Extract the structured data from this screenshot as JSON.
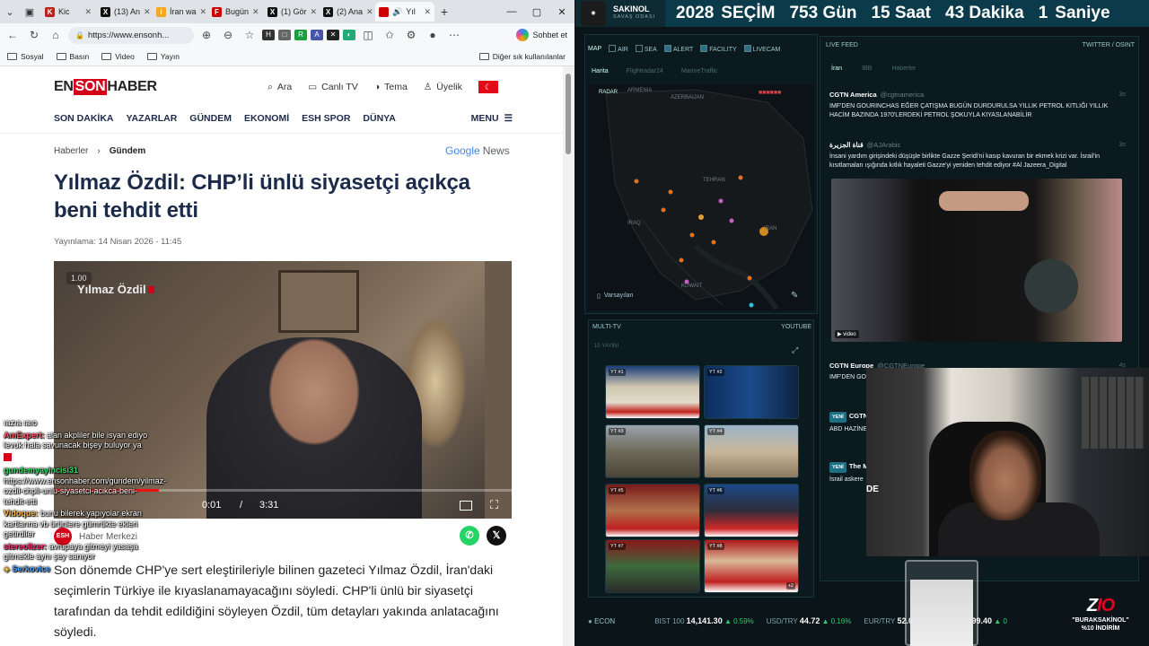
{
  "browser": {
    "tabs": [
      {
        "title": "Kic",
        "favicon": "K",
        "color": "#b22"
      },
      {
        "title": "(13) An",
        "favicon": "X",
        "color": "#111"
      },
      {
        "title": "İran wa",
        "favicon": "i",
        "color": "#f5a623"
      },
      {
        "title": "Bugün",
        "favicon": "F",
        "color": "#c00"
      },
      {
        "title": "(1) Gör",
        "favicon": "X",
        "color": "#111"
      },
      {
        "title": "(2) Ana",
        "favicon": "X",
        "color": "#111"
      },
      {
        "title": "Yıl",
        "favicon": "",
        "color": "#c00",
        "active": true
      }
    ],
    "url": "https://www.ensonh...",
    "copilot_label": "Sohbet et",
    "bookmarks": [
      "Sosyal",
      "Basın",
      "Video",
      "Yayın"
    ],
    "bookmarks_right": "Diğer sık kullanılanlar"
  },
  "site": {
    "logo": {
      "en": "EN",
      "son": "SON",
      "haber": "HABER"
    },
    "header_items": [
      {
        "icon": "search-icon",
        "label": "Ara"
      },
      {
        "icon": "tv-icon",
        "label": "Canlı TV"
      },
      {
        "icon": "theme-icon",
        "label": "Tema"
      },
      {
        "icon": "user-icon",
        "label": "Üyelik"
      }
    ],
    "nav": [
      "SON DAKİKA",
      "YAZARLAR",
      "GÜNDEM",
      "EKONOMİ",
      "ESH SPOR",
      "DÜNYA"
    ],
    "menu_label": "MENU",
    "breadcrumbs": {
      "home": "Haberler",
      "current": "Gündem"
    },
    "google_news": {
      "google": "Google",
      "news": "News"
    },
    "headline": "Yılmaz Özdil: CHP’li ünlü siyasetçi açıkça beni tehdit etti",
    "published": "Yayınlama: 14 Nisan 2026 - 11:45",
    "video": {
      "speed": "1.00",
      "name": "Yılmaz Özdil",
      "time": "0:01",
      "sep": "/",
      "duration": "3:31",
      "progress": 0.23
    },
    "source": "Haber Merkezi",
    "source_badge": "ESH",
    "article": "Son dönemde CHP'ye sert eleştirileriyle bilinen gazeteci Yılmaz Özdil, İran'daki seçimlerin Türkiye ile kıyaslanamayacağını söyledi. CHP'li ünlü bir siyasetçi tarafından da tehdit edildiğini söyleyen Özdil, tüm detayları yakında anlatacağını söyledi."
  },
  "chat": [
    {
      "user": "",
      "text": "ıazıa ıaıo",
      "color": "#ccc"
    },
    {
      "user": "AmExpert:",
      "text": " alan akpliler bile isyan ediyo levuk hala savunacak bişey buluyor ya",
      "color": "#ff5a6a"
    },
    {
      "user": "gundemyayincisi31",
      "text": " https://www.ensonhaber.com/gundem/yilmaz-ozdil-chpli-unlu-siyasetci-acikca-beni-tehdit-etti",
      "color": "#39d96a"
    },
    {
      "user": "Vidoque:",
      "text": " bunu bilerek yapıyolar ekran kartlarına vb ürünlere gümrükte ekleri getirdiler",
      "color": "#ffb84d"
    },
    {
      "user": "stereolizer:",
      "text": " avrupaya gitmeyi yasaşa gitmekle aynı şey sanıyor",
      "color": "#f06"
    },
    {
      "user": "Serkovice",
      "text": "",
      "color": "#4da6ff"
    }
  ],
  "dashboard": {
    "brand": "SAKINOL",
    "brand_sub": "SAVAŞ ODASI",
    "countdown": [
      "2028",
      "SEÇİM",
      "753 Gün",
      "15 Saat",
      "43 Dakika",
      "1",
      "Saniye"
    ],
    "map_title": "MAP",
    "map_filters": [
      {
        "label": "AIR",
        "on": false
      },
      {
        "label": "SEA",
        "on": false
      },
      {
        "label": "ALERT",
        "on": true
      },
      {
        "label": "FACILITY",
        "on": true
      },
      {
        "label": "LIVECAM",
        "on": true
      }
    ],
    "map_tabs": [
      "Harita",
      "Flightradar24",
      "MarineTraffic"
    ],
    "map_badge": "RADAR",
    "map_labels": [
      "ARMENIA",
      "AZERBAIJAN",
      "TEHRAN",
      "IRAQ",
      "IRAN",
      "KUWAIT"
    ],
    "map_default": "Varsayılan",
    "multitv_title": "MULTI-TV",
    "multitv_source": "YOUTUBE",
    "multitv_sub": "10 YAYINI",
    "tv_labels": [
      "YT #1",
      "YT #2",
      "YT #3",
      "YT #4",
      "YT #5",
      "YT #6",
      "YT #7",
      "YT #8"
    ],
    "tv_more": "+2",
    "feed_title": "LIVE FEED",
    "feed_source": "TWITTER / OSINT",
    "feed_tabs": [
      "İran",
      "İBB",
      "Haberler"
    ],
    "feed_items": [
      {
        "src": "CGTN America",
        "handle": "@cgtnamerica",
        "time": "3s",
        "text": "IMF'DEN GOURINCHAS EĞER ÇATIŞMA BUGÜN DURDURULSA YILLIK PETROL KITLIĞI YILLIK HACİM BAZINDA 1970'LERDEKİ PETROL ŞOKUYLA KIYASLANABİLİR"
      },
      {
        "src": "قناة الجزيرة",
        "handle": "@AJArabic",
        "time": "3s",
        "text": "İnsani yardım girişindeki düşüşle birlikte Gazze Şeridi'ni kasıp kavuran bir ekmek krizi var. İsrail'in kısıtlamaları ışığında kıtlık hayaleti Gazze'yi yeniden tehdit ediyor #Al Jazeera_Digital"
      },
      {
        "src": "CGTN Europe",
        "handle": "@CGTNEurope",
        "time": "4s",
        "text": "IMF'DEN GO"
      },
      {
        "src": "CGTN",
        "handle": "",
        "time": "",
        "text": "ABD HAZİNE"
      },
      {
        "src": "The M",
        "handle": "",
        "time": "",
        "text": "İsrail askere"
      }
    ],
    "video_badge": "▶ video",
    "new_badge": "YENİ",
    "econ": {
      "label": "ECON",
      "items": [
        {
          "name": "BIST 100",
          "value": "14,141.30",
          "change": "▲ 0.59%"
        },
        {
          "name": "USD/TRY",
          "value": "44.72",
          "change": "▲ 0.16%"
        },
        {
          "name": "EUR/TRY",
          "value": "52.01",
          "change": ""
        },
        {
          "name": "",
          "value": "4,799.40",
          "change": "▲ 0"
        }
      ]
    }
  },
  "overlay": {
    "zio_z": "Z",
    "zio_io": "IO",
    "promo": "\"BURAKSAKİNOL\"",
    "discount": "%10 İNDİRİM",
    "webcam_sign": "DE"
  }
}
